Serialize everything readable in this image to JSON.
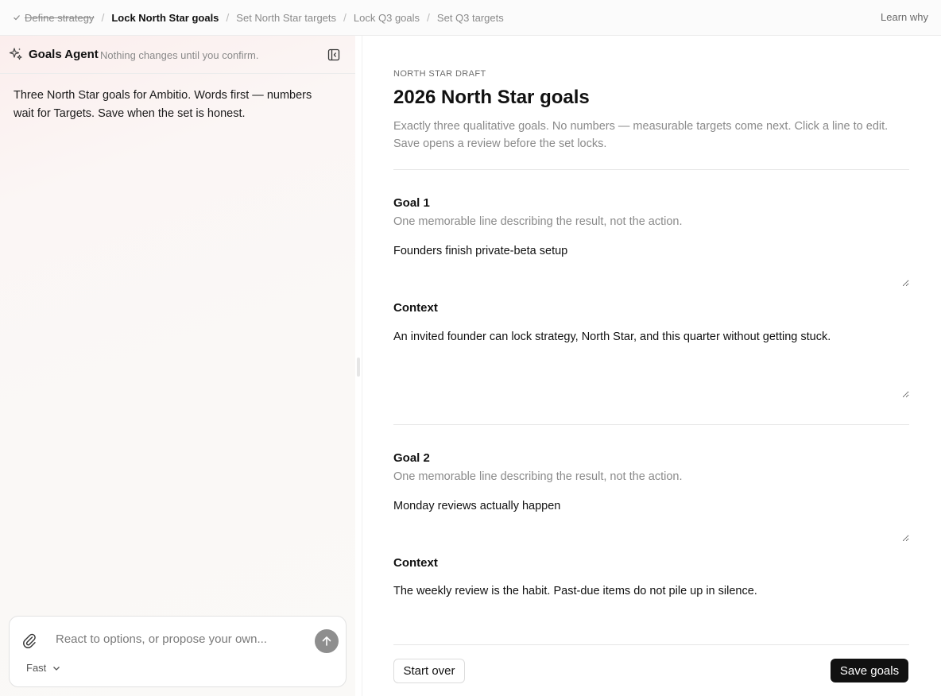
{
  "breadcrumbs": {
    "steps": [
      {
        "label": "Define strategy",
        "state": "done"
      },
      {
        "label": "Lock North Star goals",
        "state": "active"
      },
      {
        "label": "Set North Star targets",
        "state": "upcoming"
      },
      {
        "label": "Lock Q3 goals",
        "state": "upcoming"
      },
      {
        "label": "Set Q3 targets",
        "state": "upcoming"
      }
    ],
    "separator": "/",
    "learn_why": "Learn why"
  },
  "agent": {
    "title": "Goals Agent",
    "subtitle": "Nothing changes until you confirm.",
    "message": "Three North Star goals for Ambitio. Words first — numbers wait for Targets. Save when the set is honest.",
    "composer": {
      "placeholder": "React to options, or propose your own...",
      "model": "Fast"
    }
  },
  "main": {
    "eyebrow": "NORTH STAR DRAFT",
    "title": "2026 North Star goals",
    "description": "Exactly three qualitative goals. No numbers — measurable targets come next. Click a line to edit. Save opens a review before the set locks.",
    "goals": [
      {
        "label": "Goal 1",
        "help": "One memorable line describing the result, not the action.",
        "value": "Founders finish private-beta setup",
        "context_label": "Context",
        "context": "An invited founder can lock strategy, North Star, and this quarter without getting stuck."
      },
      {
        "label": "Goal 2",
        "help": "One memorable line describing the result, not the action.",
        "value": "Monday reviews actually happen",
        "context_label": "Context",
        "context": "The weekly review is the habit. Past-due items do not pile up in silence."
      }
    ],
    "actions": {
      "start_over": "Start over",
      "save": "Save goals"
    }
  },
  "colors": {
    "accent": "#111111",
    "muted_text": "#8a8a8a",
    "send_button": "#8e8e8e"
  }
}
